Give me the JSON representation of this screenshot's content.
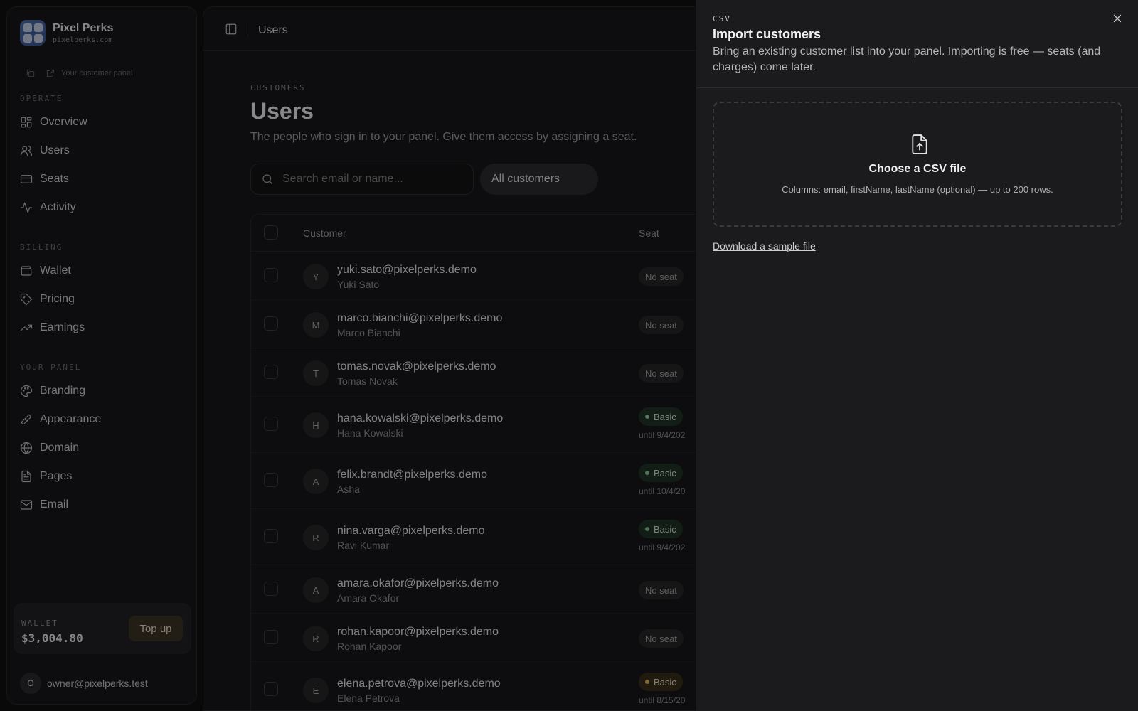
{
  "brand": {
    "name": "Pixel Perks",
    "domain": "pixelperks.com",
    "panel_link": "Your customer panel"
  },
  "nav": {
    "operate_label": "OPERATE",
    "operate": [
      {
        "label": "Overview",
        "icon": "grid-icon"
      },
      {
        "label": "Users",
        "icon": "users-icon"
      },
      {
        "label": "Seats",
        "icon": "card-icon"
      },
      {
        "label": "Activity",
        "icon": "activity-icon"
      }
    ],
    "billing_label": "BILLING",
    "billing": [
      {
        "label": "Wallet",
        "icon": "wallet-icon"
      },
      {
        "label": "Pricing",
        "icon": "tag-icon"
      },
      {
        "label": "Earnings",
        "icon": "trending-up-icon"
      }
    ],
    "panel_label": "YOUR PANEL",
    "panel": [
      {
        "label": "Branding",
        "icon": "palette-icon"
      },
      {
        "label": "Appearance",
        "icon": "brush-icon"
      },
      {
        "label": "Domain",
        "icon": "globe-icon"
      },
      {
        "label": "Pages",
        "icon": "file-icon"
      },
      {
        "label": "Email",
        "icon": "mail-icon"
      }
    ]
  },
  "wallet": {
    "label": "WALLET",
    "amount": "$3,004.80",
    "topup": "Top up"
  },
  "account": {
    "initial": "O",
    "email": "owner@pixelperks.test"
  },
  "topbar": {
    "crumb": "Users"
  },
  "page": {
    "eyebrow": "CUSTOMERS",
    "title": "Users",
    "subtitle": "The people who sign in to your panel. Give them access by assigning a seat.",
    "search_placeholder": "Search email or name...",
    "filter": "All customers"
  },
  "table": {
    "headers": {
      "customer": "Customer",
      "seat": "Seat"
    },
    "rows": [
      {
        "initial": "Y",
        "email": "yuki.sato@pixelperks.demo",
        "name": "Yuki Sato",
        "seat": "No seat",
        "until": ""
      },
      {
        "initial": "M",
        "email": "marco.bianchi@pixelperks.demo",
        "name": "Marco Bianchi",
        "seat": "No seat",
        "until": ""
      },
      {
        "initial": "T",
        "email": "tomas.novak@pixelperks.demo",
        "name": "Tomas Novak",
        "seat": "No seat",
        "until": ""
      },
      {
        "initial": "H",
        "email": "hana.kowalski@pixelperks.demo",
        "name": "Hana Kowalski",
        "seat": "Basic",
        "until": "until 9/4/202"
      },
      {
        "initial": "A",
        "email": "felix.brandt@pixelperks.demo",
        "name": "Asha",
        "seat": "Basic",
        "until": "until 10/4/20"
      },
      {
        "initial": "R",
        "email": "nina.varga@pixelperks.demo",
        "name": "Ravi Kumar",
        "seat": "Basic",
        "until": "until 9/4/202"
      },
      {
        "initial": "A",
        "email": "amara.okafor@pixelperks.demo",
        "name": "Amara Okafor",
        "seat": "No seat",
        "until": ""
      },
      {
        "initial": "R",
        "email": "rohan.kapoor@pixelperks.demo",
        "name": "Rohan Kapoor",
        "seat": "No seat",
        "until": ""
      },
      {
        "initial": "E",
        "email": "elena.petrova@pixelperks.demo",
        "name": "Elena Petrova",
        "seat": "Basic",
        "until": "until 8/15/20"
      }
    ]
  },
  "drawer": {
    "eyebrow": "CSV",
    "title": "Import customers",
    "description": "Bring an existing customer list into your panel. Importing is free — seats (and charges) come later.",
    "dropzone_title": "Choose a CSV file",
    "dropzone_sub": "Columns: email, firstName, lastName (optional) — up to 200 rows.",
    "sample_link": "Download a sample file"
  },
  "colors": {
    "background": "#101011",
    "surface": "#18181a",
    "drawer": "#1b1b1d",
    "seat_basic": "#1e3325",
    "seat_basic_amber": "#3a2f1a"
  }
}
